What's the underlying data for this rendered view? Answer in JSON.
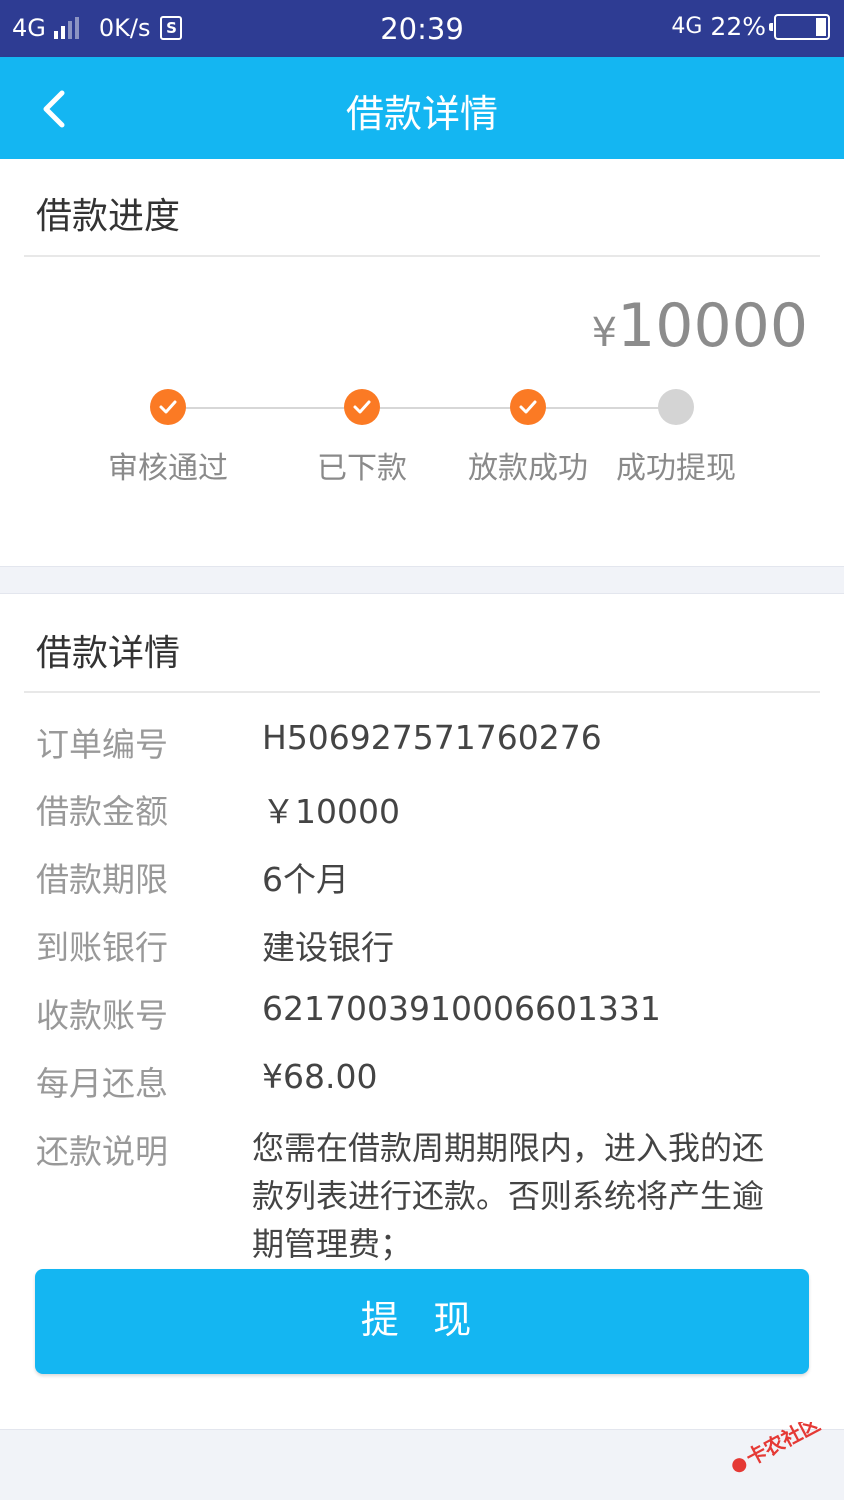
{
  "status_bar": {
    "network": "4G",
    "speed": "0K/s",
    "time": "20:39",
    "network_right": "4G",
    "battery": "22%"
  },
  "nav": {
    "title": "借款详情",
    "back_icon": "chevron-left-icon"
  },
  "progress": {
    "title": "借款进度",
    "amount_symbol": "¥",
    "amount": "10000",
    "steps": [
      {
        "label": "审核通过",
        "done": true
      },
      {
        "label": "已下款",
        "done": true
      },
      {
        "label": "放款成功",
        "done": true
      },
      {
        "label": "成功提现",
        "done": false
      }
    ],
    "accent_color": "#fb7a24"
  },
  "details": {
    "title": "借款详情",
    "rows": [
      {
        "label": "订单编号",
        "value": "H506927571760276"
      },
      {
        "label": "借款金额",
        "value": "￥10000"
      },
      {
        "label": "借款期限",
        "value": "6个月"
      },
      {
        "label": "到账银行",
        "value": "建设银行"
      },
      {
        "label": "收款账号",
        "value": "6217003910006601331"
      },
      {
        "label": "每月还息",
        "value": "¥68.00"
      }
    ],
    "note_label": "还款说明",
    "note_value": "您需在借款周期期限内，进入我的还款列表进行还款。否则系统将产生逾期管理费；"
  },
  "actions": {
    "withdraw_label": "提 现"
  },
  "watermark": {
    "text": "卡农社区"
  },
  "colors": {
    "status_bar": "#2e3c93",
    "nav_bar": "#14b6f2",
    "button": "#14b6f2"
  }
}
